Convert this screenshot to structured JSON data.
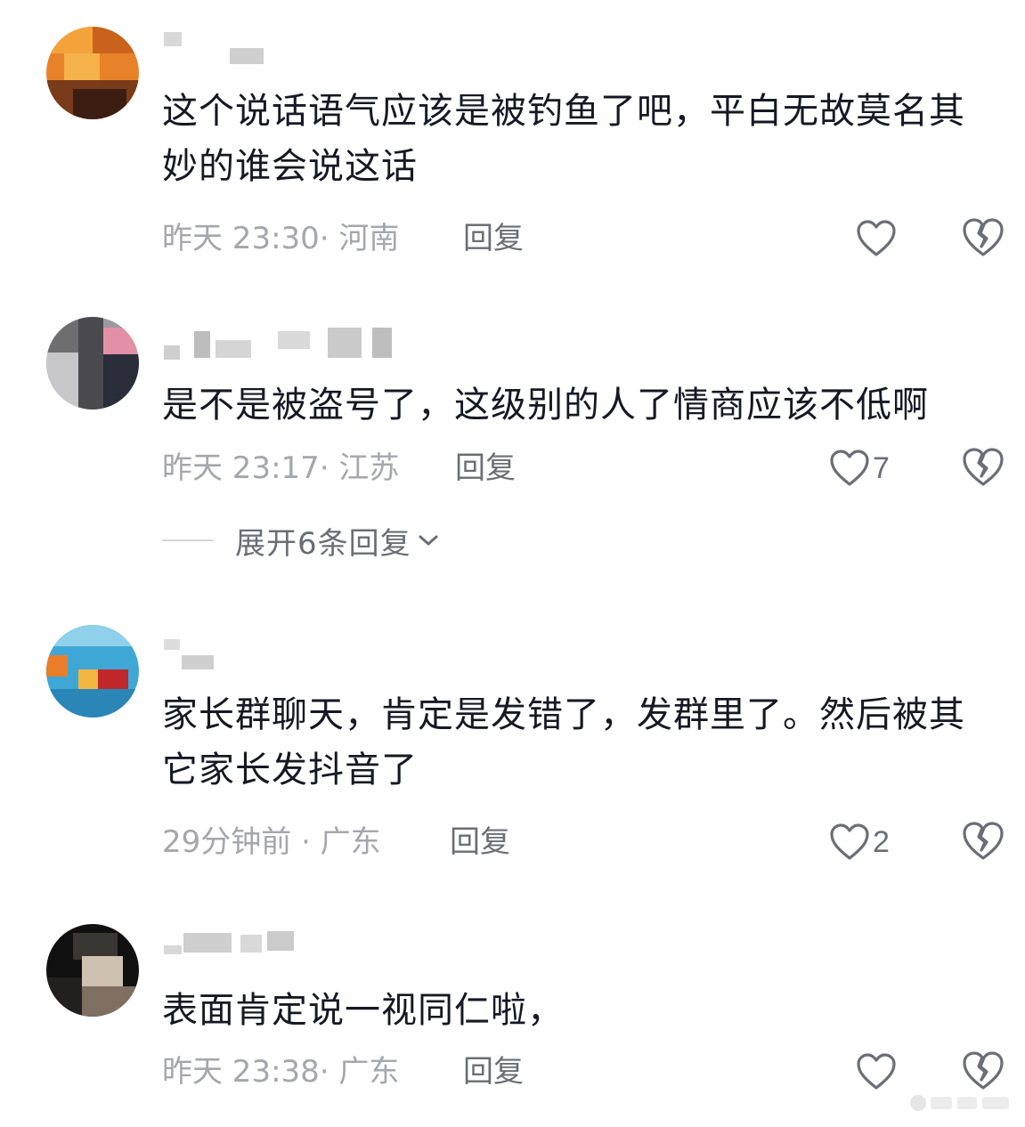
{
  "comments": [
    {
      "text": "这个说话语气应该是被钓鱼了吧，平白无故莫名其妙的谁会说这话",
      "meta": "昨天 23:30· 河南",
      "reply_label": "回复",
      "like_count": "",
      "avatar_colors": [
        "#f4a33b",
        "#e8822a",
        "#c9631c",
        "#7a3b1a",
        "#3b1d12"
      ]
    },
    {
      "text": "是不是被盗号了，这级别的人了情商应该不低啊",
      "meta": "昨天 23:17· 江苏",
      "reply_label": "回复",
      "like_count": "7",
      "avatar_colors": [
        "#6e6e70",
        "#c7c7c9",
        "#e38fa6",
        "#2a2d3a",
        "#9a9aa0"
      ]
    },
    {
      "text": "家长群聊天，肯定是发错了，发群里了。然后被其它家长发抖音了",
      "meta": "29分钟前 · 广东",
      "reply_label": "回复",
      "like_count": "2",
      "avatar_colors": [
        "#3fa7d6",
        "#e97d2a",
        "#c0282b",
        "#f2b640",
        "#8fd0ea"
      ]
    },
    {
      "text": "表面肯定说一视同仁啦，",
      "meta": "昨天 23:38· 广东",
      "reply_label": "回复",
      "like_count": "",
      "avatar_colors": [
        "#101010",
        "#3a3632",
        "#7f6f60",
        "#cfc1b0",
        "#22201e"
      ]
    }
  ],
  "expand_replies": {
    "label": "展开6条回复"
  },
  "icons": {
    "like": "heart-outline-icon",
    "dislike": "broken-heart-icon",
    "expand": "chevron-down-icon"
  },
  "colors": {
    "text": "#161823",
    "meta": "#a5a7ad",
    "action": "#6b6e76"
  }
}
